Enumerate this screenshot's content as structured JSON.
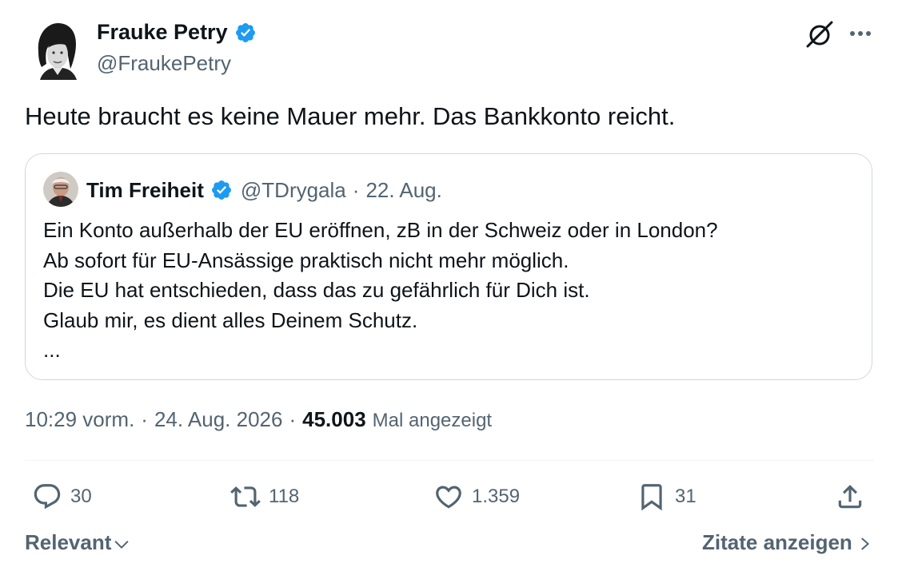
{
  "author": {
    "name": "Frauke Petry",
    "handle": "@FraukePetry",
    "verified": true
  },
  "tweet": {
    "text": "Heute braucht es keine Mauer mehr. Das Bankkonto reicht."
  },
  "quote": {
    "name": "Tim Freiheit",
    "handle": "@TDrygala",
    "separator": "·",
    "date": "22. Aug.",
    "lines": [
      "Ein Konto außerhalb der EU eröffnen, zB in der Schweiz oder in London?",
      "Ab sofort für EU-Ansässige praktisch nicht mehr möglich.",
      "Die EU hat entschieden, dass das zu gefährlich für Dich ist.",
      "Glaub mir, es dient alles Deinem Schutz.",
      "..."
    ]
  },
  "meta": {
    "time": "10:29 vorm.",
    "sep": "·",
    "date": "24. Aug. 2026",
    "views": "45.003",
    "views_label": "Mal angezeigt"
  },
  "actions": {
    "replies": "30",
    "reposts": "118",
    "likes": "1.359",
    "bookmarks": "31"
  },
  "footer": {
    "sort_label": "Relevant",
    "quotes_label": "Zitate anzeigen"
  },
  "colors": {
    "verified": "#1d9bf0",
    "text_primary": "#0f1419",
    "text_secondary": "#536471",
    "border": "#cfd9de"
  },
  "icons": [
    "verified-badge-icon",
    "grok-icon",
    "more-icon",
    "reply-icon",
    "repost-icon",
    "like-icon",
    "bookmark-icon",
    "share-icon",
    "chevron-down-icon",
    "chevron-right-icon"
  ]
}
